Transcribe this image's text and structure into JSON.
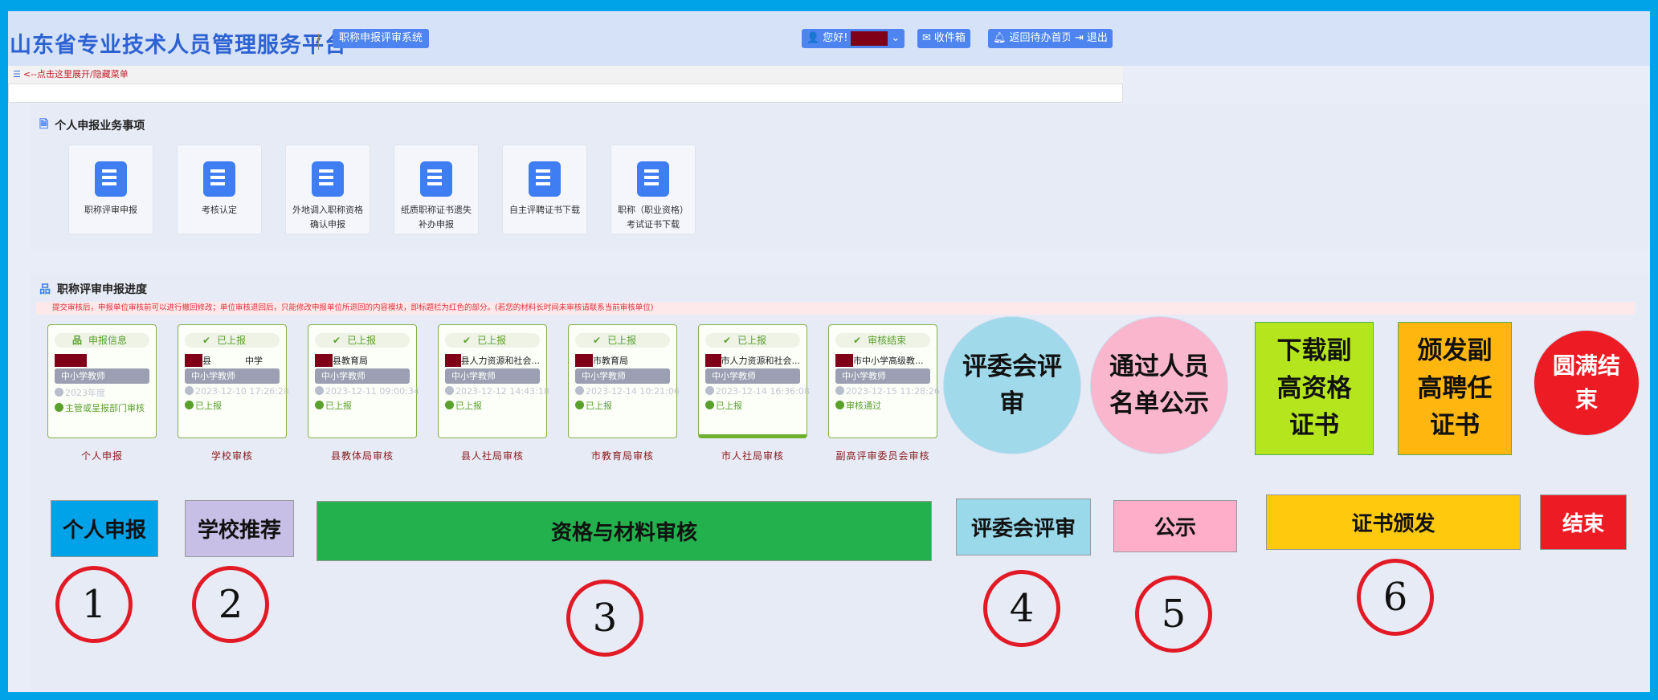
{
  "header": {
    "title": "山东省专业技术人员管理服务平台",
    "system": "职称申报评审系统",
    "greeting": "您好!",
    "inbox": "收件箱",
    "home": "返回待办首页",
    "logout": "退出"
  },
  "menu_toggle": "<--点击这里展开/隐藏菜单",
  "services": {
    "title": "个人申报业务事项",
    "tiles": [
      {
        "label": "职称评审申报",
        "icon": "edit-document-icon"
      },
      {
        "label": "考核认定",
        "icon": "user-document-icon"
      },
      {
        "label": "外地调入职称资格确认申报",
        "icon": "map-pin-icon"
      },
      {
        "label": "纸质职称证书遗失补办申报",
        "icon": "id-card-icon"
      },
      {
        "label": "自主评聘证书下载",
        "icon": "user-list-icon"
      },
      {
        "label": "职称（职业资格）考试证书下载",
        "icon": "pen-square-icon"
      }
    ]
  },
  "progress": {
    "title": "职称评审申报进度",
    "note": "提交审核后，申报单位审核前可以进行撤回修改；单位审核退回后，只能修改申报单位所退回的内容模块，即标题栏为红色的部分。(若您的材料长时间未审核请联系当前审核单位)",
    "cards": [
      {
        "status": "申报信息",
        "org": "",
        "type": "中小学教师",
        "time": "2023年度",
        "info": "主管或呈报部门审核",
        "stage": "个人申报"
      },
      {
        "status": "已上报",
        "org": "县            中学",
        "type": "中小学教师",
        "time": "2023-12-10 17:26:28",
        "info": "已上报",
        "stage": "学校审核"
      },
      {
        "status": "已上报",
        "org": "县教育局",
        "type": "中小学教师",
        "time": "2023-12-11 09:00:34",
        "info": "已上报",
        "stage": "县教体局审核"
      },
      {
        "status": "已上报",
        "org": "县人力资源和社会...",
        "type": "中小学教师",
        "time": "2023-12-12 14:43:18",
        "info": "已上报",
        "stage": "县人社局审核"
      },
      {
        "status": "已上报",
        "org": "市教育局",
        "type": "中小学教师",
        "time": "2023-12-14 10:21:06",
        "info": "已上报",
        "stage": "市教育局审核"
      },
      {
        "status": "已上报",
        "org": "市人力资源和社会...",
        "type": "中小学教师",
        "time": "2023-12-14 16:36:08",
        "info": "已上报",
        "stage": "市人社局审核"
      },
      {
        "status": "审核结束",
        "org": "市中小学高级教...",
        "type": "中小学教师",
        "time": "2023-12-15 11:28:26",
        "info": "审核通过",
        "stage": "副高评审委员会审核"
      }
    ]
  },
  "annotations": {
    "steps": [
      {
        "label": "评委会评审",
        "color": "#9fd9ea"
      },
      {
        "label": "通过人员名单公示",
        "color": "#f9b6cc"
      },
      {
        "label": "下载副高资格证书",
        "color": "#b5e61d"
      },
      {
        "label": "颁发副高聘任证书",
        "color": "#ffb60f"
      },
      {
        "label": "圆满结束",
        "color": "#ed1c24"
      }
    ],
    "phases": [
      {
        "label": "个人申报",
        "color": "#00a2e8",
        "num": "1"
      },
      {
        "label": "学校推荐",
        "color": "#c8bfe7",
        "num": "2"
      },
      {
        "label": "资格与材料审核",
        "color": "#22b14c",
        "num": "3"
      },
      {
        "label": "评委会评审",
        "color": "#99d9ea",
        "num": "4"
      },
      {
        "label": "公示",
        "color": "#ffaec9",
        "num": "5"
      },
      {
        "label": "证书颁发",
        "color": "#ffc90e",
        "num": "6"
      },
      {
        "label": "结束",
        "color": "#ed1c24"
      }
    ]
  }
}
